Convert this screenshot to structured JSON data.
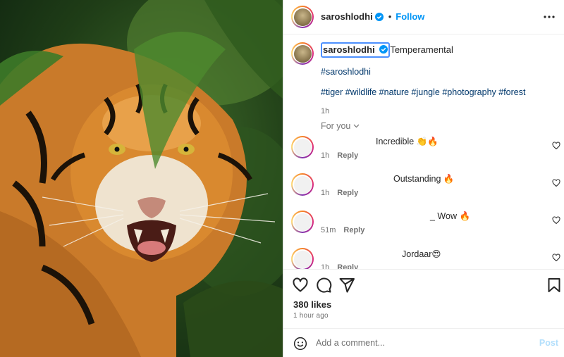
{
  "header": {
    "username": "saroshlodhi",
    "dot": "•",
    "follow_label": "Follow",
    "more_icon": "more-horizontal-icon"
  },
  "caption": {
    "username": "saroshlodhi",
    "text": "Temperamental",
    "hashtag_line_1": "#saroshlodhi",
    "hashtag_line_2": "#tiger #wildlife #nature #jungle #photography #forest",
    "time": "1h"
  },
  "for_you": {
    "label": "For you"
  },
  "comments": [
    {
      "text": "Incredible 👏🔥",
      "time": "1h",
      "reply_label": "Reply"
    },
    {
      "text": "Outstanding 🔥",
      "time": "1h",
      "reply_label": "Reply"
    },
    {
      "text": "_ Wow 🔥",
      "time": "51m",
      "reply_label": "Reply"
    },
    {
      "text": "Jordaar😍",
      "time": "1h",
      "reply_label": "Reply"
    }
  ],
  "actions": {
    "like_icon": "heart-icon",
    "comment_icon": "comment-icon",
    "share_icon": "share-icon",
    "save_icon": "bookmark-icon"
  },
  "likes": "380 likes",
  "posted_ago": "1 hour ago",
  "add_comment": {
    "placeholder": "Add a comment...",
    "post_label": "Post",
    "emoji_icon": "emoji-icon"
  },
  "colors": {
    "accent": "#0095f6",
    "link": "#00376b",
    "muted": "#737373",
    "post_disabled": "#b2dffc"
  }
}
